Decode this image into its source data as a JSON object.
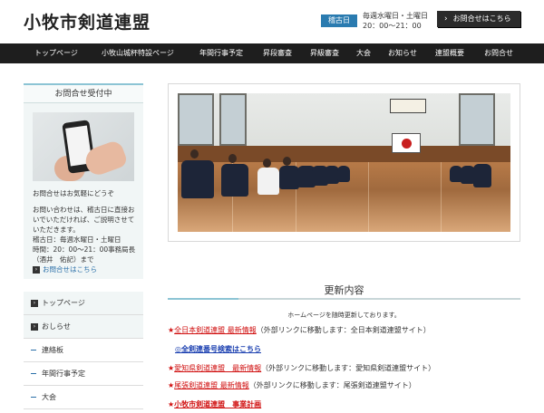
{
  "header": {
    "title": "小牧市剣道連盟",
    "hours_badge": "稽古日",
    "hours_line1": "毎週水曜日・土曜日",
    "hours_line2": "20：00〜21：00",
    "contact_label": "お問合せはこちら",
    "contact_icon": "chevron-right-icon"
  },
  "nav": {
    "items": [
      {
        "label": "トップページ"
      },
      {
        "label": "小牧山城杯特設ページ"
      },
      {
        "label": "年間行事予定"
      },
      {
        "label": "昇段審査"
      },
      {
        "label": "昇級審査"
      },
      {
        "label": "大会"
      },
      {
        "label": "お知らせ"
      },
      {
        "label": "連盟概要"
      },
      {
        "label": "お問合せ"
      }
    ]
  },
  "sidebar": {
    "box_title": "お問合せ受付中",
    "line1": "お問合せはお気軽にどうぞ",
    "line2": "お問い合わせは、稽古日に直接おいでいただければ、ご説明させていただきます。",
    "line3": "稽古日：毎週水曜日・土曜日",
    "line4": "時間：20：00〜21：00事務局長（酒井　佑記）まで",
    "link": "お問合せはこちら",
    "menu": [
      {
        "label": "トップページ"
      },
      {
        "label": "おしらせ"
      },
      {
        "label": "連絡板"
      },
      {
        "label": "年間行事予定"
      },
      {
        "label": "大会"
      }
    ]
  },
  "main": {
    "update_title": "更新内容",
    "update_note": "ホームページを随時更新しております。",
    "news": [
      {
        "star": "★",
        "link": "全日本剣道連盟 最新情報",
        "note": "（外部リンクに移動します：全日本剣道連盟サイト）"
      },
      {
        "star": "",
        "link": "◎全剣連番号検索はこちら",
        "note": ""
      },
      {
        "star": "★",
        "link": "愛知県剣道連盟　最新情報",
        "note": "（外部リンクに移動します：愛知県剣道連盟サイト）"
      },
      {
        "star": "★",
        "link": "尾張剣道連盟 最新情報",
        "note": "（外部リンクに移動します：尾張剣道連盟サイト）"
      },
      {
        "star": "★",
        "link": "小牧市剣道連盟　事業計画",
        "note": ""
      }
    ]
  },
  "colors": {
    "accent": "#8cc4d4",
    "badge": "#2a7bb0",
    "nav_bg": "#1e1e1e",
    "news_red": "#d01010",
    "news_blue": "#1a3fb0"
  }
}
